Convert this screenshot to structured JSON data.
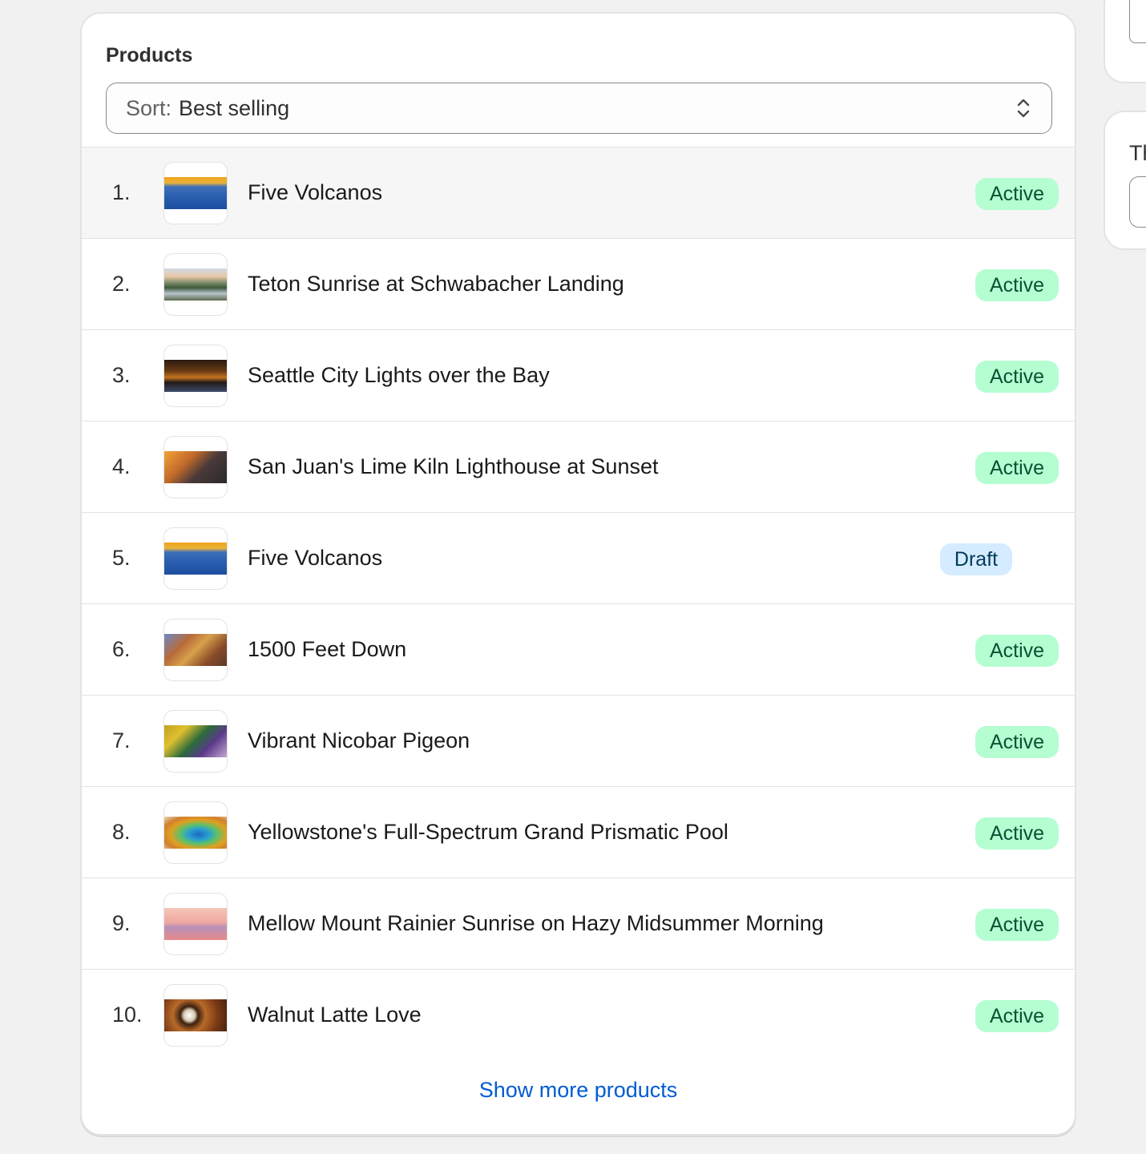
{
  "card": {
    "title": "Products",
    "sort": {
      "prefix": "Sort:",
      "value": "Best selling"
    },
    "show_more": "Show more products"
  },
  "products": [
    {
      "rank": "1.",
      "name": "Five Volcanos",
      "status": "Active",
      "thumb": "volcanos"
    },
    {
      "rank": "2.",
      "name": "Teton Sunrise at Schwabacher Landing",
      "status": "Active",
      "thumb": "teton"
    },
    {
      "rank": "3.",
      "name": "Seattle City Lights over the Bay",
      "status": "Active",
      "thumb": "seattle"
    },
    {
      "rank": "4.",
      "name": "San Juan's Lime Kiln Lighthouse at Sunset",
      "status": "Active",
      "thumb": "lighthouse"
    },
    {
      "rank": "5.",
      "name": "Five Volcanos",
      "status": "Draft",
      "thumb": "volcanos"
    },
    {
      "rank": "6.",
      "name": "1500 Feet Down",
      "status": "Active",
      "thumb": "canyon"
    },
    {
      "rank": "7.",
      "name": "Vibrant Nicobar Pigeon",
      "status": "Active",
      "thumb": "pigeon"
    },
    {
      "rank": "8.",
      "name": "Yellowstone's Full-Spectrum Grand Prismatic Pool",
      "status": "Active",
      "thumb": "prismatic"
    },
    {
      "rank": "9.",
      "name": "Mellow Mount Rainier Sunrise on Hazy Midsummer Morning",
      "status": "Active",
      "thumb": "rainier"
    },
    {
      "rank": "10.",
      "name": "Walnut Latte Love",
      "status": "Active",
      "thumb": "latte"
    }
  ],
  "side_panel": {
    "label": "Th"
  },
  "colors": {
    "active_badge_bg": "#b4fed2",
    "active_badge_text": "#0c5132",
    "draft_badge_bg": "#d5ebff",
    "draft_badge_text": "#003a5a",
    "link": "#005bd3"
  }
}
